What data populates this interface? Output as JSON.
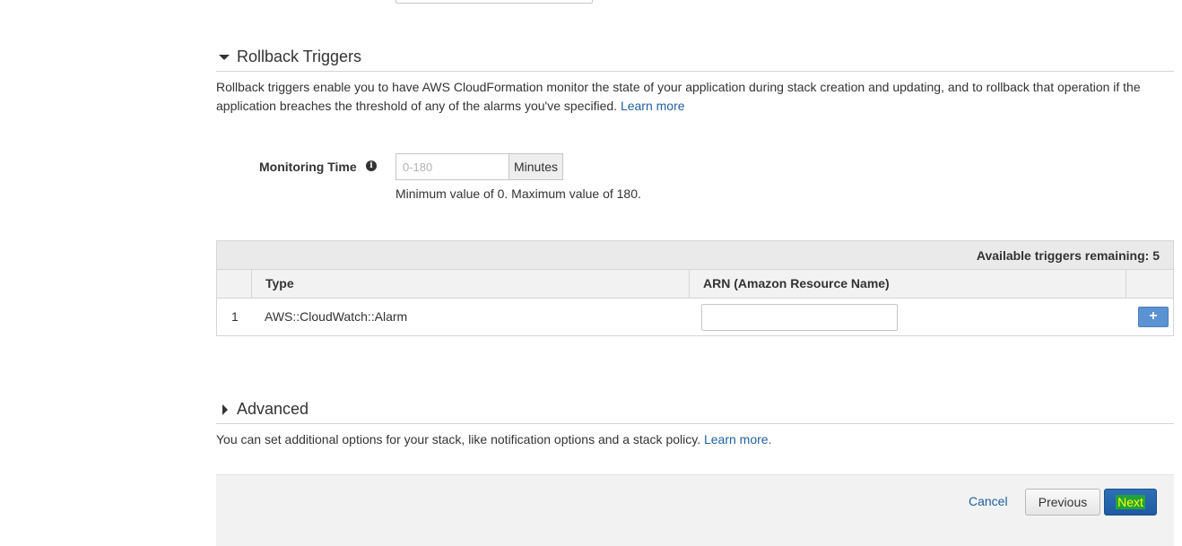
{
  "rollback": {
    "title": "Rollback Triggers",
    "description": "Rollback triggers enable you to have AWS CloudFormation monitor the state of your application during stack creation and updating, and to rollback that operation if the application breaches the threshold of any of the alarms you've specified.",
    "learn_more": "Learn more",
    "monitoring_label": "Monitoring Time",
    "monitoring_placeholder": "0-180",
    "monitoring_unit": "Minutes",
    "monitoring_hint": "Minimum value of 0. Maximum value of 180."
  },
  "triggers_table": {
    "remaining": "Available triggers remaining: 5",
    "col_type": "Type",
    "col_arn": "ARN (Amazon Resource Name)",
    "rows": [
      {
        "num": "1",
        "type": "AWS::CloudWatch::Alarm",
        "arn": ""
      }
    ],
    "add_symbol": "+"
  },
  "advanced": {
    "title": "Advanced",
    "description": "You can set additional options for your stack, like notification options and a stack policy.",
    "learn_more": "Learn more."
  },
  "footer": {
    "cancel": "Cancel",
    "previous": "Previous",
    "next": "Next"
  },
  "icons": {
    "info": "info-icon",
    "rollback_caret": "caret-down-icon",
    "advanced_caret": "caret-right-icon",
    "add": "plus-icon"
  }
}
